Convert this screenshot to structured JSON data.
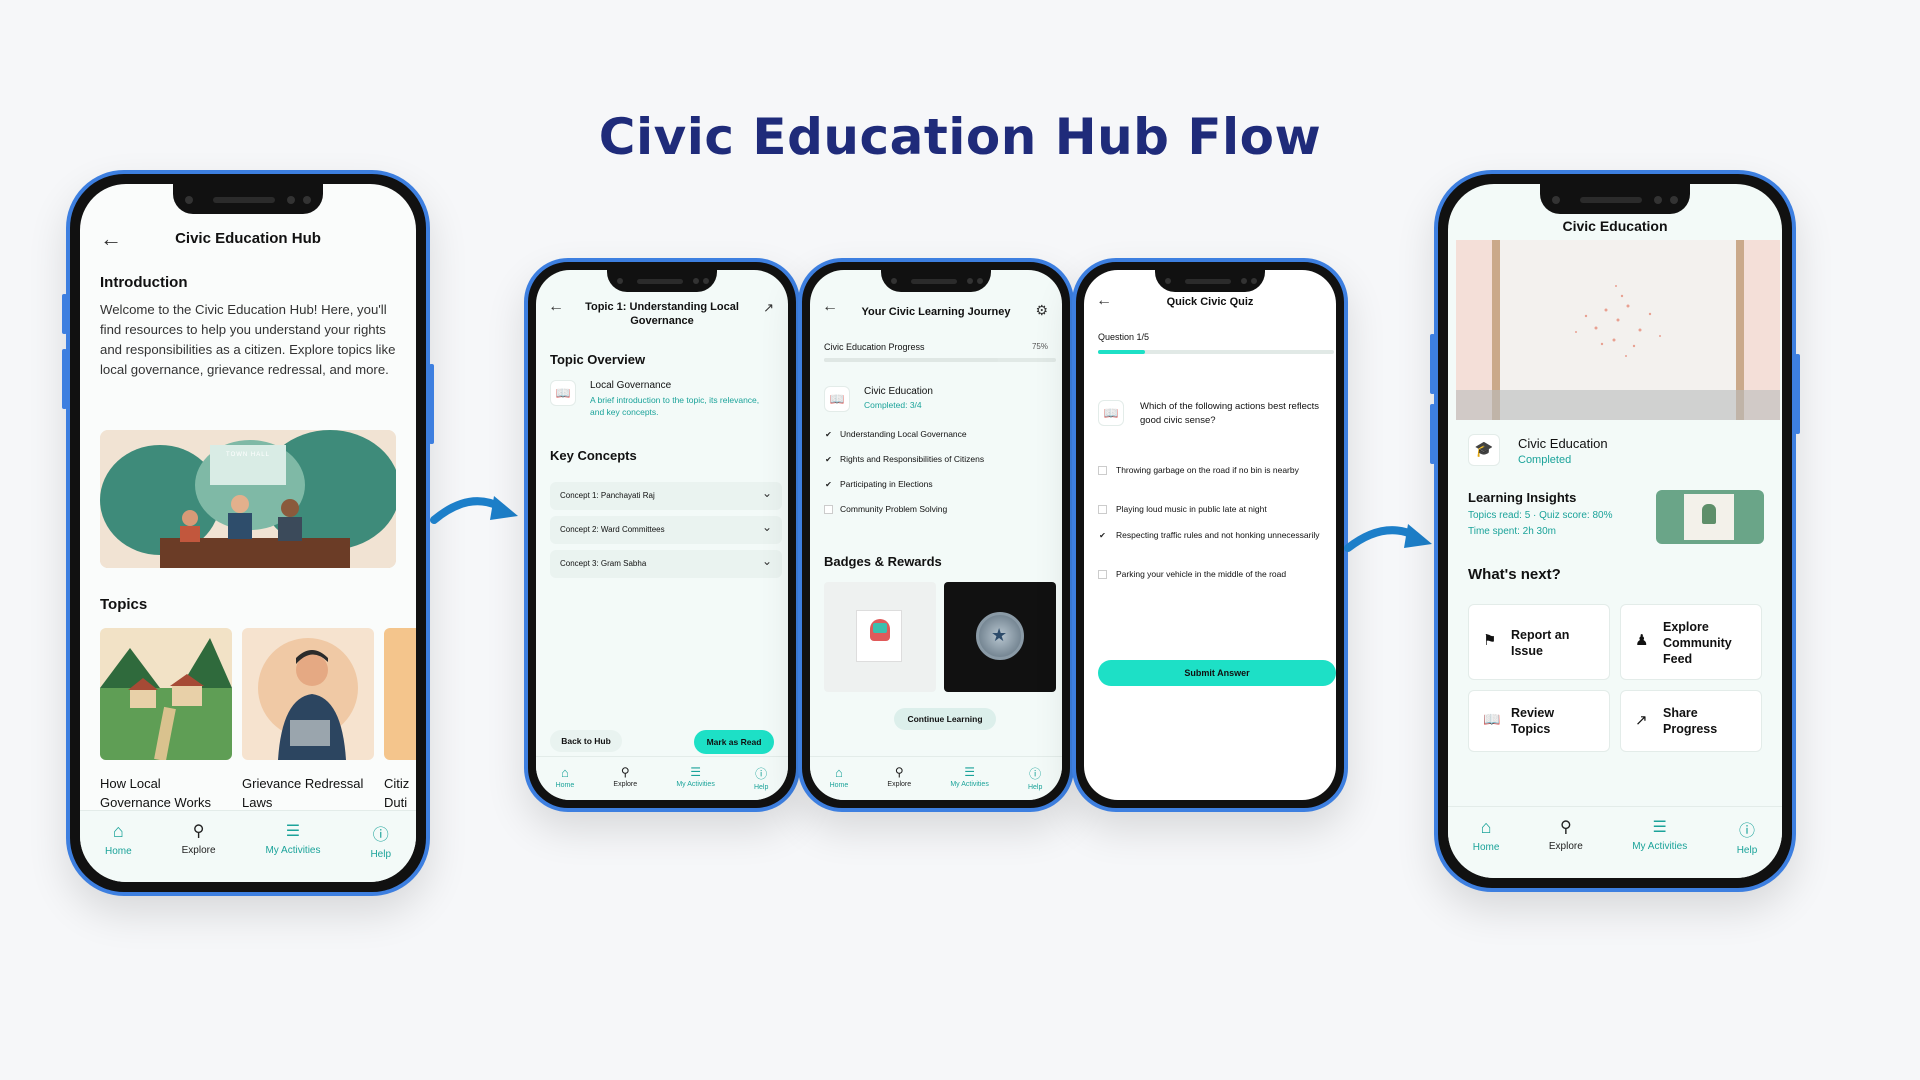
{
  "flow_title": "Civic Education Hub Flow",
  "nav": {
    "home": "Home",
    "explore": "Explore",
    "activities": "My Activities",
    "help": "Help"
  },
  "screen1": {
    "title": "Civic Education Hub",
    "intro_heading": "Introduction",
    "intro_text": "Welcome to the Civic Education Hub! Here, you'll find resources to help you understand your rights and responsibilities as a citizen. Explore topics like local governance, grievance redressal, and more.",
    "hero_sign": "TOWN HALL",
    "topics_heading": "Topics",
    "topics": [
      {
        "label": "How Local Governance Works"
      },
      {
        "label": "Grievance Redressal Laws"
      },
      {
        "label": "Citiz Duti"
      }
    ]
  },
  "screen2": {
    "title": "Topic 1: Understanding Local Governance",
    "overview_heading": "Topic Overview",
    "overview_title": "Local Governance",
    "overview_desc": "A brief introduction to the topic, its relevance, and key concepts.",
    "concepts_heading": "Key Concepts",
    "concepts": [
      "Concept 1: Panchayati Raj",
      "Concept 2: Ward Committees",
      "Concept 3: Gram Sabha"
    ],
    "back_button": "Back to Hub",
    "mark_button": "Mark as Read"
  },
  "screen3": {
    "title": "Your Civic Learning Journey",
    "progress_label": "Civic Education Progress",
    "progress_value": "75%",
    "progress_fraction": 0.75,
    "course_title": "Civic Education",
    "course_status": "Completed: 3/4",
    "modules": [
      {
        "label": "Understanding Local Governance",
        "checked": true
      },
      {
        "label": "Rights and Responsibilities of Citizens",
        "checked": true
      },
      {
        "label": "Participating in Elections",
        "checked": true
      },
      {
        "label": "Community Problem Solving",
        "checked": false
      }
    ],
    "badges_heading": "Badges & Rewards",
    "continue_button": "Continue Learning"
  },
  "screen4": {
    "title": "Quick Civic Quiz",
    "question_count": "Question 1/5",
    "progress_fraction": 0.2,
    "question": "Which of the following actions best reflects good civic sense?",
    "options": [
      {
        "label": "Throwing garbage on the road if no bin is nearby",
        "checked": false
      },
      {
        "label": "Playing loud music in public late at night",
        "checked": false
      },
      {
        "label": "Respecting traffic rules and not honking unnecessarily",
        "checked": true
      },
      {
        "label": "Parking your vehicle in the middle of the road",
        "checked": false
      }
    ],
    "submit_button": "Submit Answer"
  },
  "screen5": {
    "title": "Civic Education",
    "course_title": "Civic Education",
    "course_status": "Completed",
    "insights_heading": "Learning Insights",
    "insights_line1": "Topics read: 5 · Quiz score: 80%",
    "insights_line2": "Time spent: 2h 30m",
    "next_heading": "What's next?",
    "actions": [
      "Report an Issue",
      "Explore Community Feed",
      "Review Topics",
      "Share Progress"
    ]
  },
  "colors": {
    "accent": "#1ba39a",
    "button": "#1de0c6",
    "title": "#1f2b7a",
    "frame": "#3d7fe0"
  }
}
